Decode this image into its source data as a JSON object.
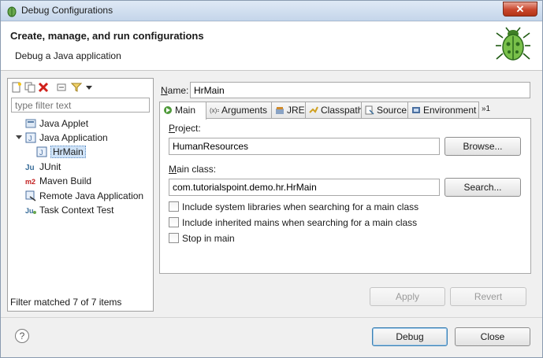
{
  "window": {
    "title": "Debug Configurations",
    "close_glyph": "✕"
  },
  "header": {
    "title": "Create, manage, and run configurations",
    "subtitle": "Debug a Java application",
    "icon": "bug-icon"
  },
  "left": {
    "filter_placeholder": "type filter text",
    "toolbar_icons": [
      "new-config-icon",
      "duplicate-icon",
      "delete-icon",
      "collapse-all-icon",
      "filter-icon",
      "dropdown-arrow-icon"
    ],
    "tree": [
      {
        "label": "Java Applet",
        "icon": "java-applet-icon",
        "level": 1
      },
      {
        "label": "Java Application",
        "icon": "java-application-icon",
        "level": 1,
        "expanded": true
      },
      {
        "label": "HrMain",
        "icon": "java-application-icon",
        "level": 2,
        "selected": true
      },
      {
        "label": "JUnit",
        "icon": "junit-icon",
        "level": 1
      },
      {
        "label": "Maven Build",
        "icon": "maven-icon",
        "level": 1
      },
      {
        "label": "Remote Java Application",
        "icon": "remote-java-icon",
        "level": 1
      },
      {
        "label": "Task Context Test",
        "icon": "task-context-icon",
        "level": 1
      }
    ],
    "status": "Filter matched 7 of 7 items"
  },
  "main": {
    "name_label": "Name:",
    "name_value": "HrMain",
    "tabs": [
      {
        "label": "Main",
        "icon": "main-tab-icon",
        "active": true
      },
      {
        "label": "Arguments",
        "icon": "arguments-icon"
      },
      {
        "label": "JRE",
        "icon": "jre-icon"
      },
      {
        "label": "Classpath",
        "icon": "classpath-icon"
      },
      {
        "label": "Source",
        "icon": "source-icon"
      },
      {
        "label": "Environment",
        "icon": "environment-icon"
      },
      {
        "label": "»1",
        "icon": "overflow-icon"
      }
    ],
    "project_label": "Project:",
    "project_value": "HumanResources",
    "browse_label": "Browse...",
    "main_class_label": "Main class:",
    "main_class_value": "com.tutorialspoint.demo.hr.HrMain",
    "search_label": "Search...",
    "checkboxes": [
      {
        "label": "Include system libraries when searching for a main class",
        "checked": false
      },
      {
        "label": "Include inherited mains when searching for a main class",
        "checked": false
      },
      {
        "label": "Stop in main",
        "checked": false
      }
    ],
    "apply_label": "Apply",
    "revert_label": "Revert"
  },
  "footer": {
    "help_glyph": "?",
    "debug_label": "Debug",
    "close_label": "Close"
  },
  "colors": {
    "selection": "#cfe3f8",
    "title_bar": "#c4d5ea",
    "close_red": "#c9462c"
  }
}
